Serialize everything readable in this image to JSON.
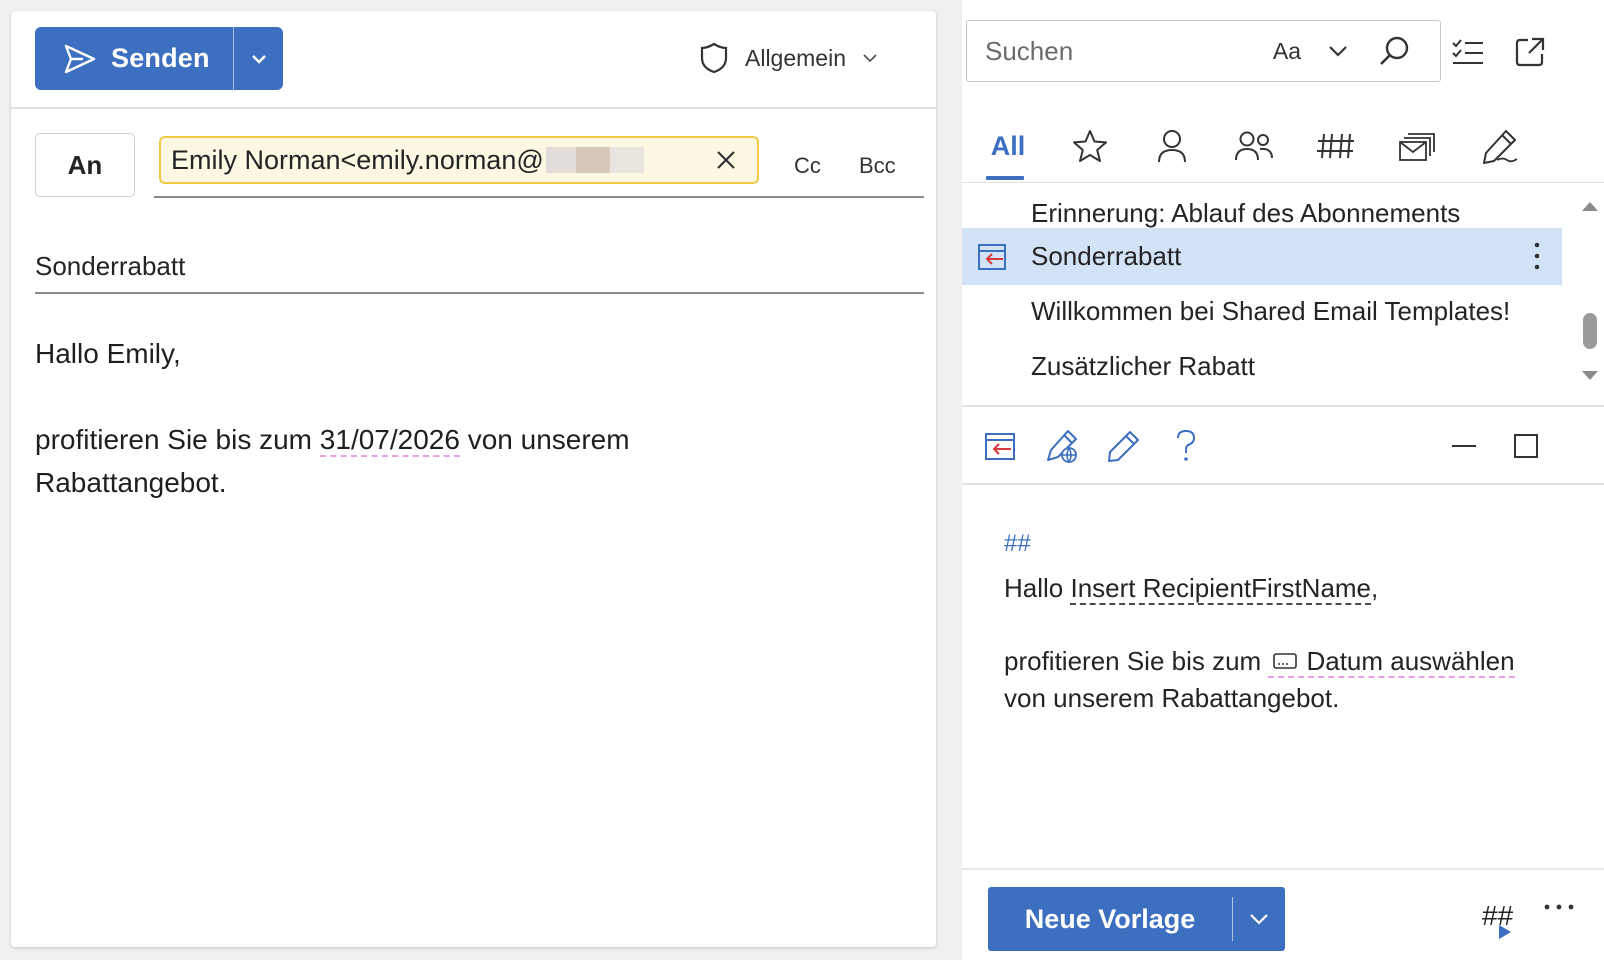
{
  "compose": {
    "send_label": "Senden",
    "sensitivity": "Allgemein",
    "to_label": "An",
    "recipient": "Emily Norman<emily.norman@",
    "cc_label": "Cc",
    "bcc_label": "Bcc",
    "subject": "Sonderrabatt",
    "body": {
      "greeting": "Hallo Emily,",
      "line1_before": "profitieren Sie bis zum ",
      "line1_date": "31/07/2026",
      "line1_after": " von unserem",
      "line2": "Rabattangebot."
    }
  },
  "panel": {
    "search_placeholder": "Suchen",
    "match_case_label": "Aa",
    "tabs": [
      {
        "label": "All",
        "icon": "all"
      },
      {
        "icon": "star-icon"
      },
      {
        "icon": "person-icon"
      },
      {
        "icon": "people-icon"
      },
      {
        "icon": "hash-icon"
      },
      {
        "icon": "mail-stack-icon"
      },
      {
        "icon": "pen-icon"
      }
    ],
    "templates": [
      {
        "title": "Erinnerung: Ablauf des Abonnements",
        "selected": false
      },
      {
        "title": "Sonderrabatt",
        "selected": true
      },
      {
        "title": "Willkommen bei Shared Email Templates!",
        "selected": false
      },
      {
        "title": "Zusätzlicher Rabatt",
        "selected": false
      }
    ],
    "preview": {
      "hash": "##",
      "hello": "Hallo ",
      "macro": "Insert RecipientFirstName",
      "comma": ",",
      "line2_before": "profitieren Sie bis zum ",
      "date_macro": "Datum auswählen",
      "line3": "von unserem Rabattangebot."
    },
    "new_template_label": "Neue Vorlage",
    "footer_hash": "##"
  },
  "colors": {
    "accent": "#3d6fc0",
    "selected_row": "#d2e2f7",
    "recipient_bg": "#fdf8e3",
    "recipient_border": "#f1c946"
  }
}
